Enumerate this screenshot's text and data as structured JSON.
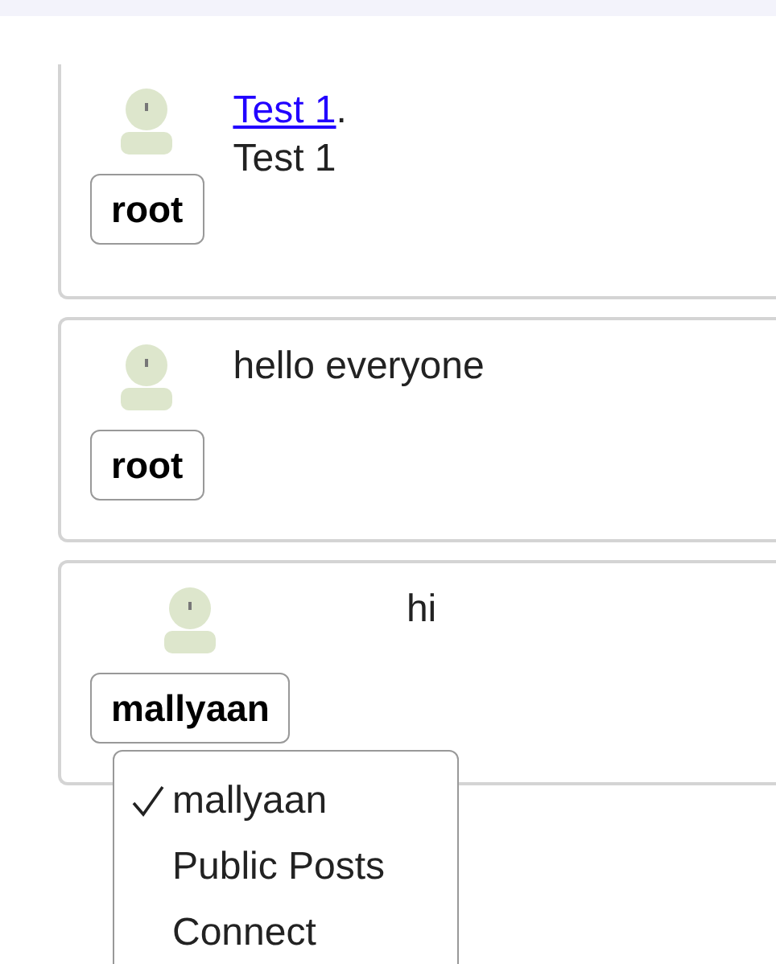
{
  "posts": [
    {
      "author": "root",
      "title": "Test 1",
      "title_end": ".",
      "body": "Test 1"
    },
    {
      "author": "root",
      "body": "hello everyone"
    },
    {
      "author": "mallyaan",
      "body": "hi"
    }
  ],
  "author_menu": {
    "items": [
      {
        "label": "mallyaan",
        "selected": true
      },
      {
        "label": "Public Posts",
        "selected": false
      },
      {
        "label": "Connect",
        "selected": false
      }
    ]
  }
}
